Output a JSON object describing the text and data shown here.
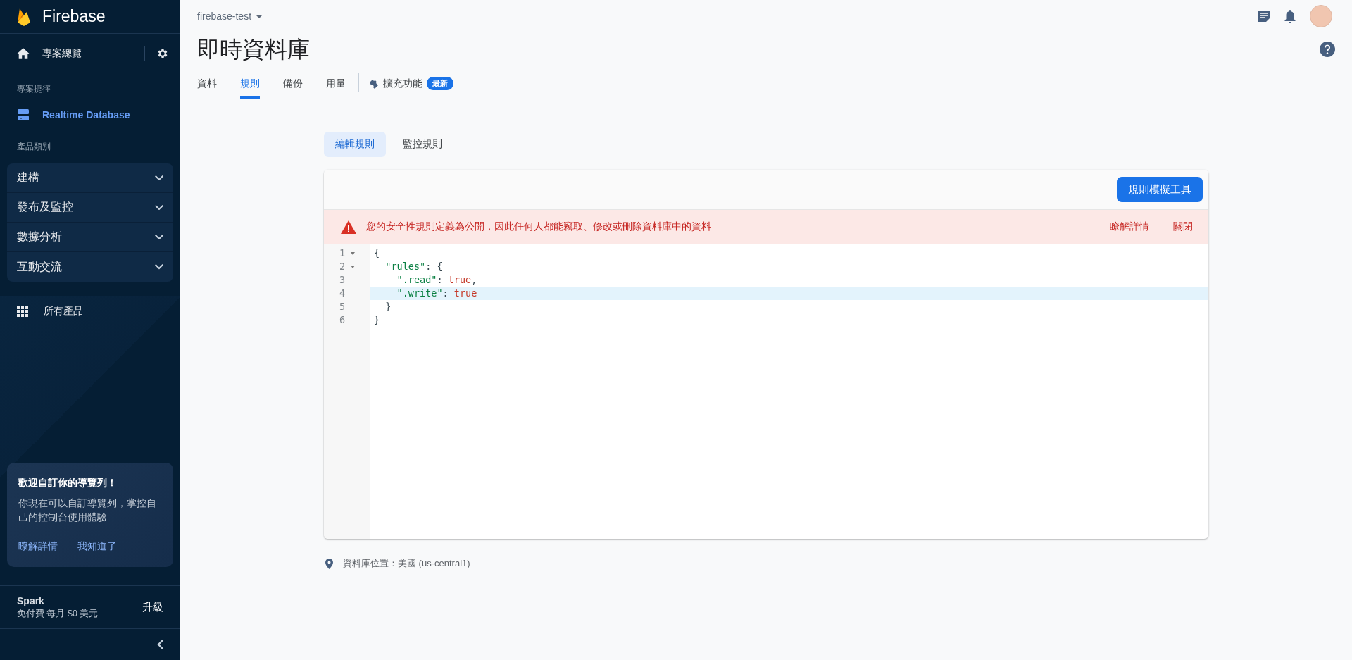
{
  "sidebar": {
    "brand": "Firebase",
    "overview": "專案總覽",
    "shortcuts_label": "專案捷徑",
    "shortcut": {
      "label": "Realtime Database",
      "selected": true
    },
    "categories_label": "產品類別",
    "groups": [
      {
        "label": "建構",
        "expanded": false
      },
      {
        "label": "發布及監控",
        "expanded": false
      },
      {
        "label": "數據分析",
        "expanded": false
      },
      {
        "label": "互動交流",
        "expanded": false
      }
    ],
    "all_products": "所有產品",
    "promo": {
      "title": "歡迎自訂你的導覽列！",
      "body": "你現在可以自訂導覽列，掌控自己的控制台使用體驗",
      "links": [
        "瞭解詳情",
        "我知道了"
      ]
    },
    "plan": {
      "name": "Spark",
      "detail": "免付費 每月 $0 美元",
      "action": "升級"
    }
  },
  "header": {
    "project": "firebase-test",
    "title": "即時資料庫",
    "tabs": [
      {
        "label": "資料",
        "selected": false,
        "kind": "plain"
      },
      {
        "label": "規則",
        "selected": true,
        "kind": "plain"
      },
      {
        "label": "備份",
        "selected": false,
        "kind": "plain"
      },
      {
        "label": "用量",
        "selected": false,
        "kind": "plain"
      },
      {
        "label": "擴充功能",
        "selected": false,
        "kind": "extension",
        "badge": "最新"
      }
    ]
  },
  "subtabs": [
    {
      "label": "編輯規則",
      "selected": true
    },
    {
      "label": "監控規則",
      "selected": false
    }
  ],
  "editor": {
    "simulator_button": "規則模擬工具",
    "warning": {
      "message": "您的安全性規則定義為公開，因此任何人都能竊取、修改或刪除資料庫中的資料",
      "actions": [
        "瞭解詳情",
        "關閉"
      ]
    },
    "lines": [
      {
        "number": "1",
        "foldable": true,
        "highlighted": false,
        "tokens": [
          {
            "kind": "punct",
            "text": "{"
          }
        ]
      },
      {
        "number": "2",
        "foldable": true,
        "highlighted": false,
        "tokens": [
          {
            "kind": "string",
            "text": "  \"rules\""
          },
          {
            "kind": "punct",
            "text": ": {"
          }
        ]
      },
      {
        "number": "3",
        "foldable": false,
        "highlighted": false,
        "tokens": [
          {
            "kind": "string",
            "text": "    \".read\""
          },
          {
            "kind": "punct",
            "text": ": "
          },
          {
            "kind": "atom",
            "text": "true"
          },
          {
            "kind": "punct",
            "text": ","
          }
        ]
      },
      {
        "number": "4",
        "foldable": false,
        "highlighted": true,
        "tokens": [
          {
            "kind": "string",
            "text": "    \".write\""
          },
          {
            "kind": "punct",
            "text": ": "
          },
          {
            "kind": "atom",
            "text": "true"
          }
        ]
      },
      {
        "number": "5",
        "foldable": false,
        "highlighted": false,
        "tokens": [
          {
            "kind": "punct",
            "text": "  }"
          }
        ]
      },
      {
        "number": "6",
        "foldable": false,
        "highlighted": false,
        "tokens": [
          {
            "kind": "punct",
            "text": "}"
          }
        ]
      }
    ]
  },
  "location": "資料庫位置：美國 (us-central1)"
}
